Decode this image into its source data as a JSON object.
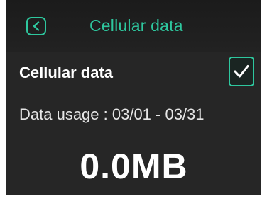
{
  "header": {
    "back_icon": "chevron-left-icon",
    "title": "Cellular data"
  },
  "toggle": {
    "label": "Cellular data",
    "checked": true,
    "check_icon": "checkmark-icon"
  },
  "usage": {
    "label": "Data usage : 03/01 - 03/31",
    "value": "0.0MB"
  },
  "colors": {
    "accent": "#2ec79e",
    "background": "#262626",
    "text": "#ffffff"
  }
}
